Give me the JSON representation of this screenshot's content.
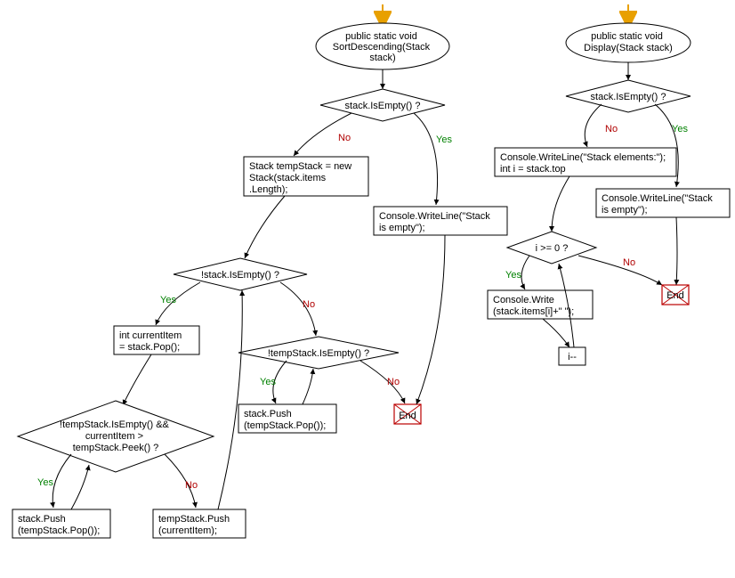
{
  "diagram": {
    "sort": {
      "start": "public static void\nSortDescending(Stack\nstack)",
      "isEmpty": "stack.IsEmpty() ?",
      "tempStackInit": "Stack tempStack = new\nStack(stack.items\n.Length);",
      "writeEmpty": "Console.WriteLine(\"Stack\nis empty\");",
      "loop1": "!stack.IsEmpty() ?",
      "currentItem": "int currentItem\n= stack.Pop();",
      "innerCond": "!tempStack.IsEmpty() &&\ncurrentItem >\ntempStack.Peek() ?",
      "pushBack": "stack.Push\n(tempStack.Pop());",
      "pushTemp": "tempStack.Push\n(currentItem);",
      "loop2": "!tempStack.IsEmpty() ?",
      "pushFinal": "stack.Push\n(tempStack.Pop());",
      "end": "End"
    },
    "display": {
      "start": "public static void\nDisplay(Stack stack)",
      "isEmpty": "stack.IsEmpty() ?",
      "writeElems": "Console.WriteLine(\"Stack elements:\");\nint i = stack.top",
      "writeEmpty": "Console.WriteLine(\"Stack\nis empty\");",
      "loopCond": "i >= 0 ?",
      "writeItem": "Console.Write\n(stack.items[i]+\" \");",
      "decr": "i--",
      "end": "End"
    },
    "labels": {
      "yes": "Yes",
      "no": "No"
    }
  },
  "chart_data": [
    {
      "type": "flowchart",
      "title": "SortDescending",
      "nodes": [
        {
          "id": "s1",
          "kind": "start",
          "text": "public static void SortDescending(Stack stack)"
        },
        {
          "id": "s2",
          "kind": "decision",
          "text": "stack.IsEmpty() ?"
        },
        {
          "id": "s3",
          "kind": "process",
          "text": "Stack tempStack = new Stack(stack.items.Length);"
        },
        {
          "id": "s4",
          "kind": "process",
          "text": "Console.WriteLine(\"Stack is empty\");"
        },
        {
          "id": "s5",
          "kind": "decision",
          "text": "!stack.IsEmpty() ?"
        },
        {
          "id": "s6",
          "kind": "process",
          "text": "int currentItem = stack.Pop();"
        },
        {
          "id": "s7",
          "kind": "decision",
          "text": "!tempStack.IsEmpty() && currentItem > tempStack.Peek() ?"
        },
        {
          "id": "s8",
          "kind": "process",
          "text": "stack.Push(tempStack.Pop());"
        },
        {
          "id": "s9",
          "kind": "process",
          "text": "tempStack.Push(currentItem);"
        },
        {
          "id": "s10",
          "kind": "decision",
          "text": "!tempStack.IsEmpty() ?"
        },
        {
          "id": "s11",
          "kind": "process",
          "text": "stack.Push(tempStack.Pop());"
        },
        {
          "id": "s12",
          "kind": "end",
          "text": "End"
        }
      ],
      "edges": [
        {
          "from": "s1",
          "to": "s2"
        },
        {
          "from": "s2",
          "to": "s3",
          "label": "No"
        },
        {
          "from": "s2",
          "to": "s4",
          "label": "Yes"
        },
        {
          "from": "s3",
          "to": "s5"
        },
        {
          "from": "s5",
          "to": "s6",
          "label": "Yes"
        },
        {
          "from": "s5",
          "to": "s10",
          "label": "No"
        },
        {
          "from": "s6",
          "to": "s7"
        },
        {
          "from": "s7",
          "to": "s8",
          "label": "Yes"
        },
        {
          "from": "s8",
          "to": "s7"
        },
        {
          "from": "s7",
          "to": "s9",
          "label": "No"
        },
        {
          "from": "s9",
          "to": "s5"
        },
        {
          "from": "s10",
          "to": "s11",
          "label": "Yes"
        },
        {
          "from": "s11",
          "to": "s10"
        },
        {
          "from": "s10",
          "to": "s12",
          "label": "No"
        },
        {
          "from": "s4",
          "to": "s12"
        }
      ]
    },
    {
      "type": "flowchart",
      "title": "Display",
      "nodes": [
        {
          "id": "d1",
          "kind": "start",
          "text": "public static void Display(Stack stack)"
        },
        {
          "id": "d2",
          "kind": "decision",
          "text": "stack.IsEmpty() ?"
        },
        {
          "id": "d3",
          "kind": "process",
          "text": "Console.WriteLine(\"Stack elements:\"); int i = stack.top"
        },
        {
          "id": "d4",
          "kind": "process",
          "text": "Console.WriteLine(\"Stack is empty\");"
        },
        {
          "id": "d5",
          "kind": "decision",
          "text": "i >= 0 ?"
        },
        {
          "id": "d6",
          "kind": "process",
          "text": "Console.Write(stack.items[i]+\" \");"
        },
        {
          "id": "d7",
          "kind": "process",
          "text": "i--"
        },
        {
          "id": "d8",
          "kind": "end",
          "text": "End"
        }
      ],
      "edges": [
        {
          "from": "d1",
          "to": "d2"
        },
        {
          "from": "d2",
          "to": "d3",
          "label": "No"
        },
        {
          "from": "d2",
          "to": "d4",
          "label": "Yes"
        },
        {
          "from": "d3",
          "to": "d5"
        },
        {
          "from": "d5",
          "to": "d6",
          "label": "Yes"
        },
        {
          "from": "d6",
          "to": "d7"
        },
        {
          "from": "d7",
          "to": "d5"
        },
        {
          "from": "d5",
          "to": "d8",
          "label": "No"
        },
        {
          "from": "d4",
          "to": "d8"
        }
      ]
    }
  ]
}
